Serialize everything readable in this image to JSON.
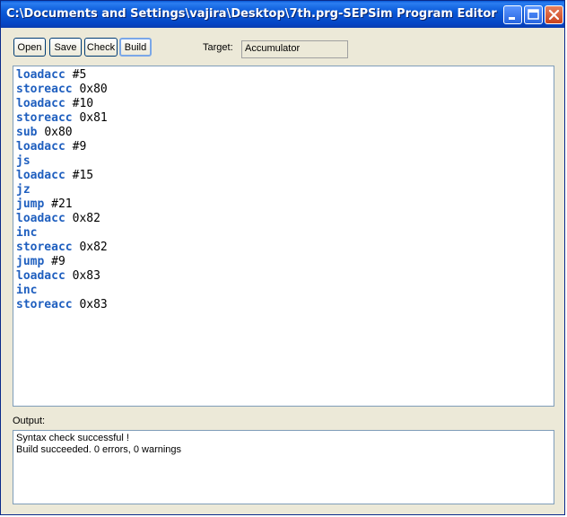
{
  "window": {
    "title": "C:\\Documents and Settings\\vajira\\Desktop\\7th.prg-SEPSim Program Editor"
  },
  "toolbar": {
    "open_label": "Open",
    "save_label": "Save",
    "check_label": "Check",
    "build_label": "Build",
    "target_label": "Target:",
    "target_value": "Accumulator"
  },
  "editor": {
    "lines": [
      {
        "keyword": "loadacc",
        "argument": "#5"
      },
      {
        "keyword": "storeacc",
        "argument": "0x80"
      },
      {
        "keyword": "loadacc",
        "argument": "#10"
      },
      {
        "keyword": "storeacc",
        "argument": "0x81"
      },
      {
        "keyword": "sub",
        "argument": "0x80"
      },
      {
        "keyword": "loadacc",
        "argument": "#9"
      },
      {
        "keyword": "js",
        "argument": ""
      },
      {
        "keyword": "loadacc",
        "argument": "#15"
      },
      {
        "keyword": "jz",
        "argument": ""
      },
      {
        "keyword": "jump",
        "argument": "#21"
      },
      {
        "keyword": "loadacc",
        "argument": "0x82"
      },
      {
        "keyword": "inc",
        "argument": ""
      },
      {
        "keyword": "storeacc",
        "argument": "0x82"
      },
      {
        "keyword": "jump",
        "argument": "#9"
      },
      {
        "keyword": "loadacc",
        "argument": "0x83"
      },
      {
        "keyword": "inc",
        "argument": ""
      },
      {
        "keyword": "storeacc",
        "argument": "0x83"
      }
    ]
  },
  "output": {
    "label": "Output:",
    "lines": [
      "Syntax check successful !",
      "Build succeeded. 0 errors, 0 warnings"
    ]
  },
  "colors": {
    "keyword": "#1f5fbf",
    "titlebar": "#0a5ad9",
    "close_button": "#c9421d"
  }
}
